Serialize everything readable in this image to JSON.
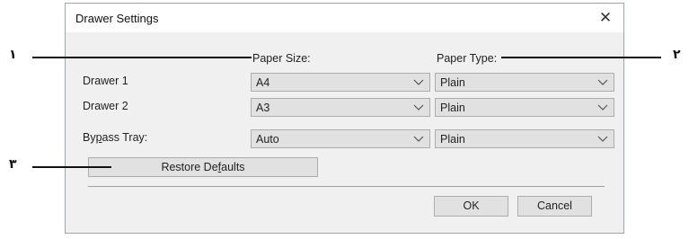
{
  "dialog": {
    "title": "Drawer Settings",
    "close_glyph": "✕",
    "header_paper_size": "Paper Size:",
    "header_paper_type": "Paper Type:",
    "rows": [
      {
        "label": "Drawer 1",
        "paper_size": "A4",
        "paper_type": "Plain"
      },
      {
        "label": "Drawer 2",
        "paper_size": "A3",
        "paper_type": "Plain"
      },
      {
        "label_pre": "By",
        "label_accel": "p",
        "label_post": "ass Tray:",
        "paper_size": "Auto",
        "paper_type": "Plain"
      }
    ],
    "restore_pre": "Restore De",
    "restore_accel": "f",
    "restore_post": "aults",
    "ok_label": "OK",
    "cancel_label": "Cancel"
  },
  "callouts": {
    "one": "١",
    "two": "٢",
    "three": "٣"
  },
  "colors": {
    "dialog_bg": "#f0f0f0",
    "control_bg": "#e1e1e1",
    "control_border": "#adadad",
    "title_bg": "#ffffff"
  }
}
